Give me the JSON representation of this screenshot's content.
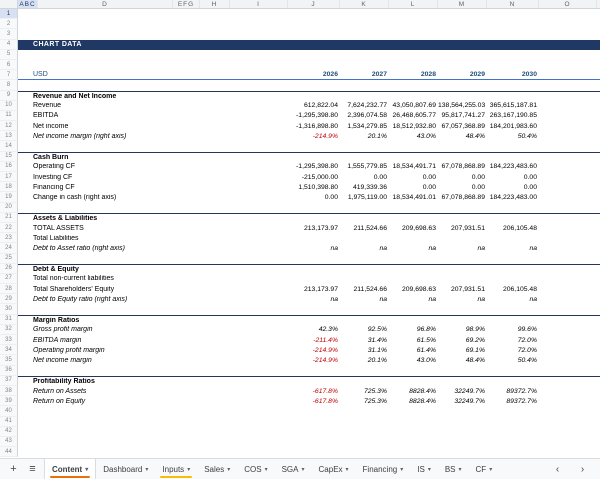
{
  "sheet": {
    "column_letters": [
      "ABC",
      "D",
      "EFG",
      "H",
      "I",
      "J",
      "K",
      "L",
      "M",
      "N",
      "O"
    ],
    "total_rows": 44,
    "title_banner": "CHART DATA",
    "colors": {
      "banner_bg": "#1f3864",
      "header_blue": "#1f4e79",
      "underline_blue": "#4472c4",
      "negative_red": "#c00000"
    },
    "rows": [
      {
        "n": 4,
        "type": "banner",
        "label": "CHART DATA"
      },
      {
        "n": 7,
        "type": "years",
        "label": "USD",
        "values": [
          "2026",
          "2027",
          "2028",
          "2029",
          "2030"
        ]
      },
      {
        "n": 9,
        "type": "section",
        "label": "Revenue and Net Income"
      },
      {
        "n": 10,
        "type": "data",
        "label": "Revenue",
        "values": [
          "612,822.04",
          "7,624,232.77",
          "43,050,807.69",
          "138,564,255.03",
          "365,615,187.81"
        ]
      },
      {
        "n": 11,
        "type": "data",
        "label": "EBITDA",
        "values": [
          "-1,295,398.80",
          "2,396,074.58",
          "26,468,605.77",
          "95,817,741.27",
          "263,167,190.85"
        ]
      },
      {
        "n": 12,
        "type": "data",
        "label": "Net income",
        "values": [
          "-1,316,898.80",
          "1,534,279.85",
          "18,512,932.80",
          "67,057,368.89",
          "184,201,983.60"
        ]
      },
      {
        "n": 13,
        "type": "data",
        "italic": true,
        "red_negatives": true,
        "label": "Net income margin (right axis)",
        "values": [
          "-214.9%",
          "20.1%",
          "43.0%",
          "48.4%",
          "50.4%"
        ]
      },
      {
        "n": 15,
        "type": "section",
        "label": "Cash Burn"
      },
      {
        "n": 16,
        "type": "data",
        "label": "Operating CF",
        "values": [
          "-1,295,398.80",
          "1,555,779.85",
          "18,534,491.71",
          "67,078,868.89",
          "184,223,483.60"
        ]
      },
      {
        "n": 17,
        "type": "data",
        "label": "Investing CF",
        "values": [
          "-215,000.00",
          "0.00",
          "0.00",
          "0.00",
          "0.00"
        ]
      },
      {
        "n": 18,
        "type": "data",
        "label": "Financing CF",
        "values": [
          "1,510,398.80",
          "419,339.36",
          "0.00",
          "0.00",
          "0.00"
        ]
      },
      {
        "n": 19,
        "type": "data",
        "label": "Change in cash (right axis)",
        "values": [
          "0.00",
          "1,975,119.00",
          "18,534,491.01",
          "67,078,868.89",
          "184,223,483.00"
        ]
      },
      {
        "n": 21,
        "type": "section",
        "label": "Assets & Liabilities"
      },
      {
        "n": 22,
        "type": "data",
        "label": "TOTAL ASSETS",
        "values": [
          "213,173.97",
          "211,524.66",
          "209,698.63",
          "207,931.51",
          "206,105.48"
        ]
      },
      {
        "n": 23,
        "type": "data",
        "label": "Total Liabilities",
        "values": [
          "",
          "",
          "",
          "",
          ""
        ]
      },
      {
        "n": 24,
        "type": "data",
        "italic": true,
        "label": "Debt to Asset ratio (right axis)",
        "values": [
          "na",
          "na",
          "na",
          "na",
          "na"
        ]
      },
      {
        "n": 26,
        "type": "section",
        "label": "Debt & Equity"
      },
      {
        "n": 27,
        "type": "data",
        "label": "Total non-current liabilities",
        "values": [
          "",
          "",
          "",
          "",
          ""
        ]
      },
      {
        "n": 28,
        "type": "data",
        "label": "Total Shareholders' Equity",
        "values": [
          "213,173.97",
          "211,524.66",
          "209,698.63",
          "207,931.51",
          "206,105.48"
        ]
      },
      {
        "n": 29,
        "type": "data",
        "italic": true,
        "label": "Debt to Equity ratio (right axis)",
        "values": [
          "na",
          "na",
          "na",
          "na",
          "na"
        ]
      },
      {
        "n": 31,
        "type": "section",
        "label": "Margin Ratios"
      },
      {
        "n": 32,
        "type": "data",
        "italic": true,
        "label": "Gross profit margin",
        "values": [
          "42.3%",
          "92.5%",
          "96.8%",
          "98.9%",
          "99.6%"
        ]
      },
      {
        "n": 33,
        "type": "data",
        "italic": true,
        "red_negatives": true,
        "label": "EBITDA margin",
        "values": [
          "-211.4%",
          "31.4%",
          "61.5%",
          "69.2%",
          "72.0%"
        ]
      },
      {
        "n": 34,
        "type": "data",
        "italic": true,
        "red_negatives": true,
        "label": "Operating profit margin",
        "values": [
          "-214.9%",
          "31.1%",
          "61.4%",
          "69.1%",
          "72.0%"
        ]
      },
      {
        "n": 35,
        "type": "data",
        "italic": true,
        "red_negatives": true,
        "label": "Net income margin",
        "values": [
          "-214.9%",
          "20.1%",
          "43.0%",
          "48.4%",
          "50.4%"
        ]
      },
      {
        "n": 37,
        "type": "section",
        "label": "Profitability Ratios"
      },
      {
        "n": 38,
        "type": "data",
        "italic": true,
        "red_negatives": true,
        "label": "Return on Assets",
        "values": [
          "-617.8%",
          "725.3%",
          "8828.4%",
          "32249.7%",
          "89372.7%"
        ]
      },
      {
        "n": 39,
        "type": "data",
        "italic": true,
        "red_negatives": true,
        "label": "Return on Equity",
        "values": [
          "-617.8%",
          "725.3%",
          "8828.4%",
          "32249.7%",
          "89372.7%"
        ]
      }
    ]
  },
  "tabbar": {
    "add_icon": "+",
    "menu_icon": "≡",
    "caret": "▾",
    "scroll_left": "‹",
    "scroll_right": "›",
    "tabs": [
      {
        "label": "Content",
        "marker": "#e8710a",
        "active": true
      },
      {
        "label": "Dashboard"
      },
      {
        "label": "Inputs",
        "marker": "#fbbc04"
      },
      {
        "label": "Sales"
      },
      {
        "label": "COS"
      },
      {
        "label": "SGA"
      },
      {
        "label": "CapEx"
      },
      {
        "label": "Financing"
      },
      {
        "label": "IS"
      },
      {
        "label": "BS"
      },
      {
        "label": "CF"
      }
    ]
  }
}
